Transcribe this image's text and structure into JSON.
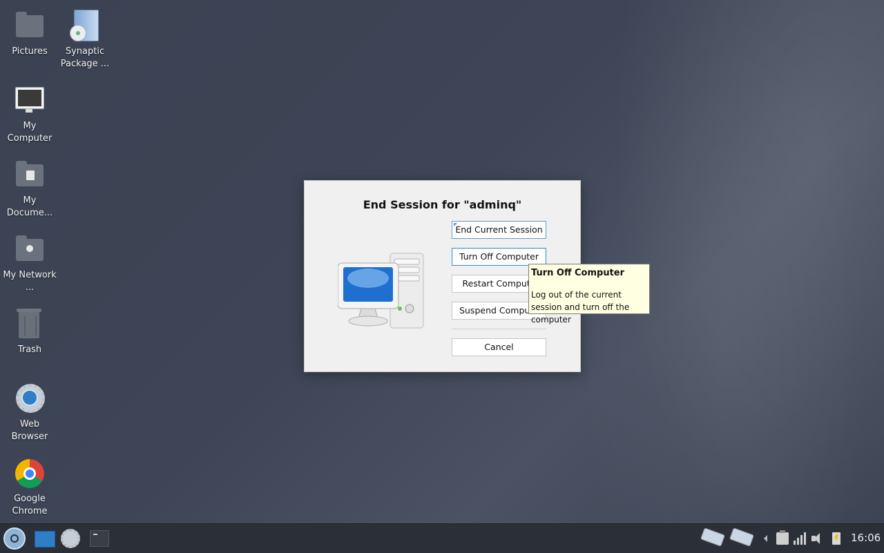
{
  "desktop": {
    "icons": [
      {
        "label": "Pictures",
        "icon": "pictures-folder-icon"
      },
      {
        "label": "Synaptic Package ...",
        "icon": "synaptic-package-icon"
      },
      {
        "label": "My Computer",
        "icon": "computer-monitor-icon"
      },
      {
        "label": "My Docume...",
        "icon": "documents-folder-icon"
      },
      {
        "label": "My Network ...",
        "icon": "network-folder-icon"
      },
      {
        "label": "Trash",
        "icon": "trash-icon"
      },
      {
        "label": "Web Browser",
        "icon": "web-browser-icon"
      },
      {
        "label": "Google Chrome",
        "icon": "chrome-icon"
      }
    ]
  },
  "dialog": {
    "title": "End Session for \"adminq\"",
    "buttons": {
      "end_current_session": "End Current Session",
      "turn_off_computer": "Turn Off Computer",
      "restart_computer": "Restart Compute",
      "suspend_computer": "Suspend Compute",
      "cancel": "Cancel"
    }
  },
  "tooltip": {
    "title": "Turn Off Computer",
    "body": "Log out of the current session and turn off the computer"
  },
  "taskbar": {
    "clock": "16:06"
  }
}
